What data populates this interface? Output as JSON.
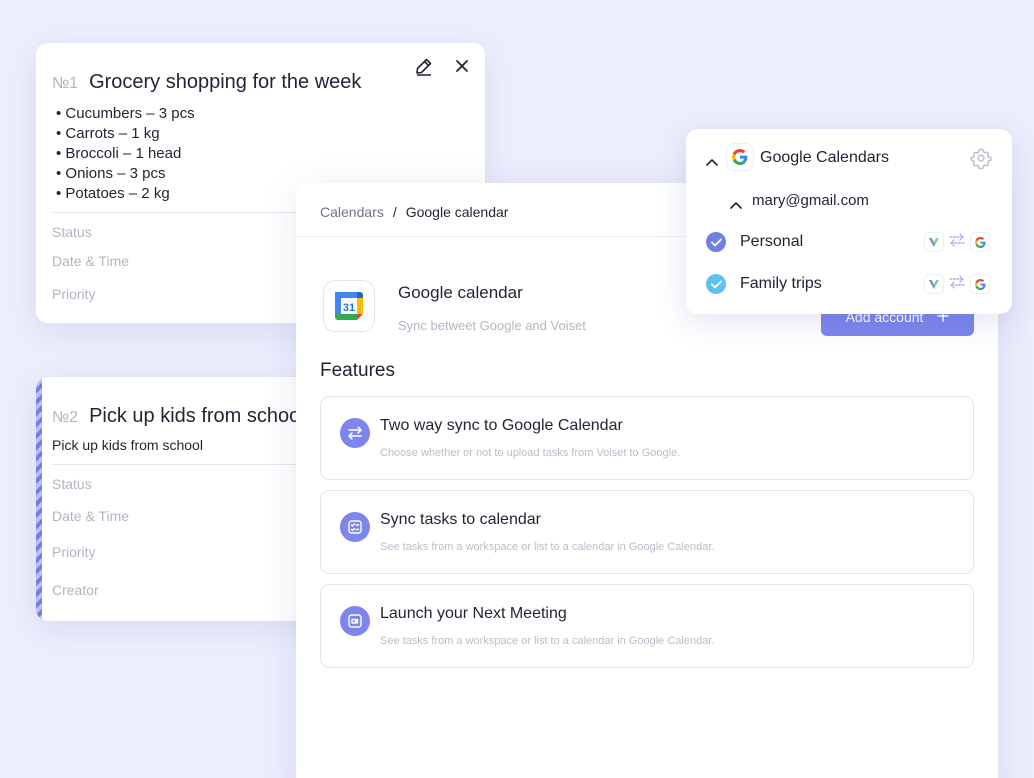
{
  "task1": {
    "number": "№1",
    "title": "Grocery shopping for the week",
    "items": [
      "Cucumbers – 3 pcs",
      "Carrots – 1 kg",
      "Broccoli – 1 head",
      "Onions – 3 pcs",
      "Potatoes – 2 kg"
    ],
    "fields": [
      "Status",
      "Date & Time",
      "Priority"
    ],
    "edit_icon": "pencil-icon",
    "close_icon": "close-icon"
  },
  "task2": {
    "number": "№2",
    "title": "Pick up kids from school",
    "description": "Pick up kids from school",
    "fields": [
      "Status",
      "Date & Time",
      "Priority",
      "Creator"
    ]
  },
  "panel": {
    "breadcrumb": {
      "root": "Calendars",
      "separator": "/",
      "current": "Google calendar"
    },
    "app_name": "Google calendar",
    "app_desc": "Sync betweet Google and Voiset",
    "add_button": "Add account",
    "features_title": "Features",
    "features": [
      {
        "title": "Two way sync to Google Calendar",
        "desc": "Choose whether or not to upload tasks from Voiset to Google.",
        "icon": "sync-arrows-icon"
      },
      {
        "title": "Sync tasks to calendar",
        "desc": "See tasks from a workspace or list to a calendar in Google Calendar.",
        "icon": "checklist-icon"
      },
      {
        "title": "Launch your Next Meeting",
        "desc": "See tasks from a workspace or list to a calendar in Google Calendar.",
        "icon": "video-icon"
      }
    ]
  },
  "gc_popup": {
    "title": "Google Calendars",
    "account": "mary@gmail.com",
    "calendars": [
      {
        "name": "Personal",
        "checked": true,
        "color": "#6f7fe4"
      },
      {
        "name": "Family trips",
        "checked": true,
        "color": "#5ec2ef"
      }
    ]
  },
  "colors": {
    "accent": "#7c86ec",
    "background": "#eceefd",
    "muted_text": "#b1b5c2"
  }
}
